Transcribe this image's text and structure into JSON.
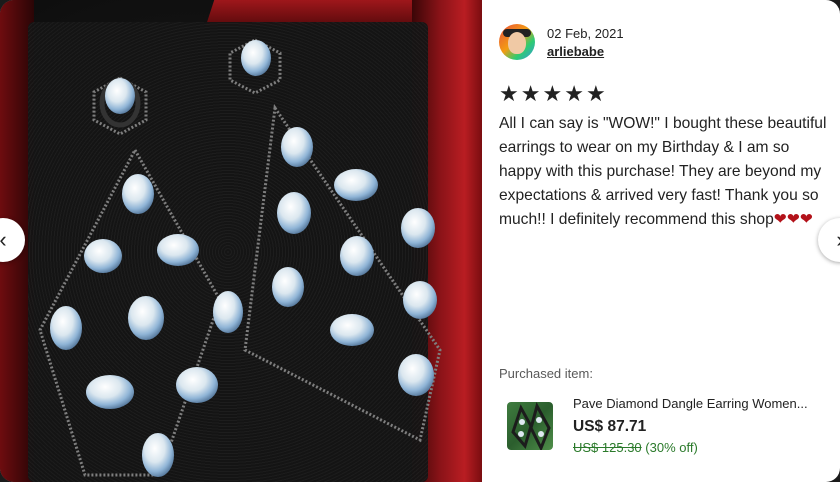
{
  "navigation": {
    "prev_icon": "‹",
    "next_icon": "›"
  },
  "review": {
    "date": "02 Feb, 2021",
    "username": "arliebabe",
    "rating": 5,
    "star_glyph": "★",
    "text": "All I can say is \"WOW!\" I bought these beautiful earrings to wear on my Birthday & I am so happy with this purchase! They are beyond my expectations & arrived very fast! Thank you so much!! I definitely recommend this shop",
    "hearts": "❤❤❤"
  },
  "purchase": {
    "label": "Purchased item:",
    "title": "Pave Diamond Dangle Earring Women...",
    "price": "US$ 87.71",
    "original_price": "US$ 125.30",
    "discount": "(30% off)"
  },
  "colors": {
    "sale_green": "#2b7a2b",
    "heart_red": "#b3121a",
    "box_red": "#b91d22"
  }
}
